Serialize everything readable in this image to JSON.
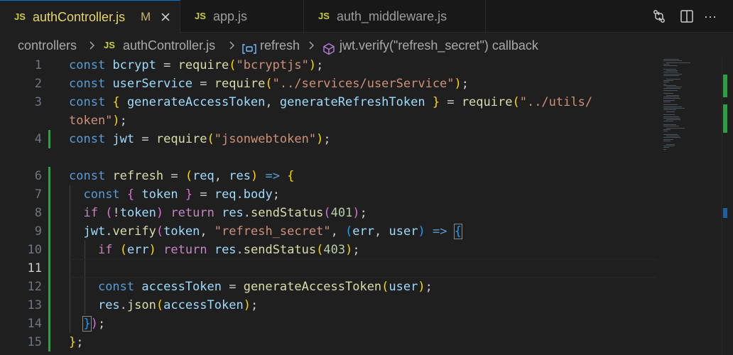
{
  "tabs": [
    {
      "lang": "JS",
      "label": "authController.js",
      "modified": "M",
      "active": true
    },
    {
      "lang": "JS",
      "label": "app.js",
      "active": false
    },
    {
      "lang": "JS",
      "label": "auth_middleware.js",
      "active": false
    }
  ],
  "actions": [
    {
      "icon": "compare-changes-icon"
    },
    {
      "icon": "split-editor-icon"
    },
    {
      "icon": "more-actions-icon",
      "text": "···"
    }
  ],
  "breadcrumb": {
    "folder": "controllers",
    "file_lang": "JS",
    "file": "authController.js",
    "symbol_variable": "refresh",
    "symbol_callback": "jwt.verify(\"refresh_secret\") callback"
  },
  "editor": {
    "current_line": 11,
    "line_numbers": [
      "1",
      "2",
      "3",
      "",
      "4",
      "",
      "6",
      "7",
      "8",
      "9",
      "10",
      "11",
      "12",
      "13",
      "14",
      "15"
    ],
    "colors": {
      "background": "#1f1f1f",
      "added_line_gutter": "#2ea043",
      "keyword": "#569cd6",
      "control": "#c586c0",
      "variable": "#9cdcfe",
      "function": "#dcdcaa",
      "string": "#ce9178",
      "number": "#b5cea8"
    },
    "lines": [
      [
        [
          "kw",
          "const"
        ],
        [
          "punc",
          " "
        ],
        [
          "var",
          "bcrypt"
        ],
        [
          "punc",
          " = "
        ],
        [
          "fn",
          "require"
        ],
        [
          "br1",
          "("
        ],
        [
          "str",
          "\"bcryptjs\""
        ],
        [
          "br1",
          ")"
        ],
        [
          "punc",
          ";"
        ]
      ],
      [
        [
          "kw",
          "const"
        ],
        [
          "punc",
          " "
        ],
        [
          "var",
          "userService"
        ],
        [
          "punc",
          " = "
        ],
        [
          "fn",
          "require"
        ],
        [
          "br1",
          "("
        ],
        [
          "str",
          "\"../services/userService\""
        ],
        [
          "br1",
          ")"
        ],
        [
          "punc",
          ";"
        ]
      ],
      [
        [
          "kw",
          "const"
        ],
        [
          "punc",
          " "
        ],
        [
          "br1",
          "{"
        ],
        [
          "punc",
          " "
        ],
        [
          "var",
          "generateAccessToken"
        ],
        [
          "punc",
          ", "
        ],
        [
          "var",
          "generateRefreshToken"
        ],
        [
          "punc",
          " "
        ],
        [
          "br1",
          "}"
        ],
        [
          "punc",
          " = "
        ],
        [
          "fn",
          "require"
        ],
        [
          "br1",
          "("
        ],
        [
          "str",
          "\"../utils/"
        ]
      ],
      [
        [
          "str",
          "token\""
        ],
        [
          "br1",
          ")"
        ],
        [
          "punc",
          ";"
        ]
      ],
      [
        [
          "kw",
          "const"
        ],
        [
          "punc",
          " "
        ],
        [
          "var",
          "jwt"
        ],
        [
          "punc",
          " = "
        ],
        [
          "fn",
          "require"
        ],
        [
          "br1",
          "("
        ],
        [
          "str",
          "\"jsonwebtoken\""
        ],
        [
          "br1",
          ")"
        ],
        [
          "punc",
          ";"
        ]
      ],
      [],
      [
        [
          "kw",
          "const"
        ],
        [
          "punc",
          " "
        ],
        [
          "fn",
          "refresh"
        ],
        [
          "punc",
          " = "
        ],
        [
          "br1",
          "("
        ],
        [
          "var",
          "req"
        ],
        [
          "punc",
          ", "
        ],
        [
          "var",
          "res"
        ],
        [
          "br1",
          ")"
        ],
        [
          "punc",
          " "
        ],
        [
          "kw",
          "=>"
        ],
        [
          "punc",
          " "
        ],
        [
          "br1",
          "{"
        ]
      ],
      [
        [
          "punc",
          "  "
        ],
        [
          "kw",
          "const"
        ],
        [
          "punc",
          " "
        ],
        [
          "br2",
          "{"
        ],
        [
          "punc",
          " "
        ],
        [
          "var",
          "token"
        ],
        [
          "punc",
          " "
        ],
        [
          "br2",
          "}"
        ],
        [
          "punc",
          " = "
        ],
        [
          "var",
          "req"
        ],
        [
          "punc",
          "."
        ],
        [
          "var",
          "body"
        ],
        [
          "punc",
          ";"
        ]
      ],
      [
        [
          "punc",
          "  "
        ],
        [
          "ctl",
          "if"
        ],
        [
          "punc",
          " "
        ],
        [
          "br2",
          "("
        ],
        [
          "punc",
          "!"
        ],
        [
          "var",
          "token"
        ],
        [
          "br2",
          ")"
        ],
        [
          "punc",
          " "
        ],
        [
          "ctl",
          "return"
        ],
        [
          "punc",
          " "
        ],
        [
          "var",
          "res"
        ],
        [
          "punc",
          "."
        ],
        [
          "fn",
          "sendStatus"
        ],
        [
          "br2",
          "("
        ],
        [
          "num",
          "401"
        ],
        [
          "br2",
          ")"
        ],
        [
          "punc",
          ";"
        ]
      ],
      [
        [
          "punc",
          "  "
        ],
        [
          "var",
          "jwt"
        ],
        [
          "punc",
          "."
        ],
        [
          "fn",
          "verify"
        ],
        [
          "br2",
          "("
        ],
        [
          "var",
          "token"
        ],
        [
          "punc",
          ", "
        ],
        [
          "str",
          "\"refresh_secret\""
        ],
        [
          "punc",
          ", "
        ],
        [
          "br3",
          "("
        ],
        [
          "var",
          "err"
        ],
        [
          "punc",
          ", "
        ],
        [
          "var",
          "user"
        ],
        [
          "br3",
          ")"
        ],
        [
          "punc",
          " "
        ],
        [
          "kw",
          "=>"
        ],
        [
          "punc",
          " "
        ],
        [
          "br3m",
          "{"
        ]
      ],
      [
        [
          "punc",
          "    "
        ],
        [
          "ctl",
          "if"
        ],
        [
          "punc",
          " "
        ],
        [
          "br1",
          "("
        ],
        [
          "var",
          "err"
        ],
        [
          "br1",
          ")"
        ],
        [
          "punc",
          " "
        ],
        [
          "ctl",
          "return"
        ],
        [
          "punc",
          " "
        ],
        [
          "var",
          "res"
        ],
        [
          "punc",
          "."
        ],
        [
          "fn",
          "sendStatus"
        ],
        [
          "br1",
          "("
        ],
        [
          "num",
          "403"
        ],
        [
          "br1",
          ")"
        ],
        [
          "punc",
          ";"
        ]
      ],
      [],
      [
        [
          "punc",
          "    "
        ],
        [
          "kw",
          "const"
        ],
        [
          "punc",
          " "
        ],
        [
          "var",
          "accessToken"
        ],
        [
          "punc",
          " = "
        ],
        [
          "fn",
          "generateAccessToken"
        ],
        [
          "br1",
          "("
        ],
        [
          "var",
          "user"
        ],
        [
          "br1",
          ")"
        ],
        [
          "punc",
          ";"
        ]
      ],
      [
        [
          "punc",
          "    "
        ],
        [
          "var",
          "res"
        ],
        [
          "punc",
          "."
        ],
        [
          "fn",
          "json"
        ],
        [
          "br1",
          "("
        ],
        [
          "var",
          "accessToken"
        ],
        [
          "br1",
          ")"
        ],
        [
          "punc",
          ";"
        ]
      ],
      [
        [
          "punc",
          "  "
        ],
        [
          "br3m",
          "}"
        ],
        [
          "br2",
          ")"
        ],
        [
          "punc",
          ";"
        ]
      ],
      [
        [
          "br1",
          "}"
        ],
        [
          "punc",
          ";"
        ]
      ]
    ]
  }
}
